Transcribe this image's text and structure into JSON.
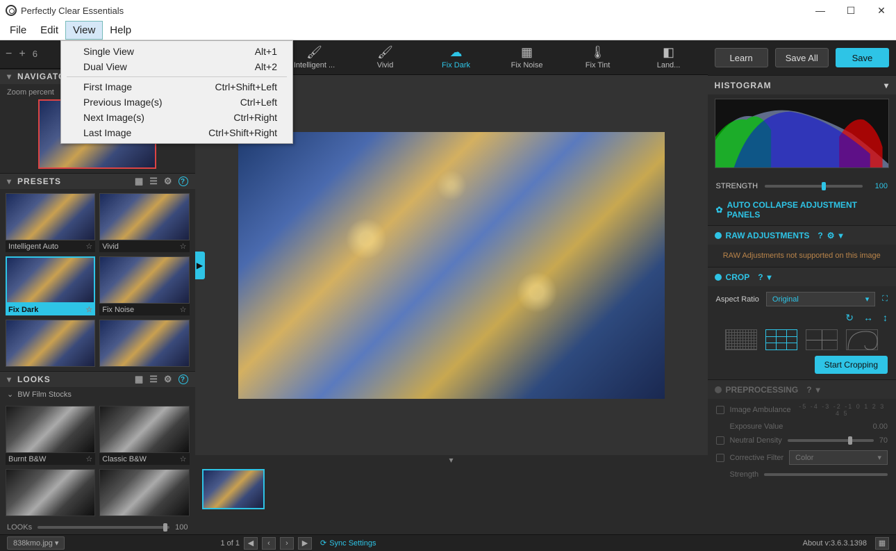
{
  "app": {
    "title": "Perfectly Clear Essentials"
  },
  "menubar": {
    "file": "File",
    "edit": "Edit",
    "view": "View",
    "help": "Help"
  },
  "view_menu": {
    "single_view": "Single View",
    "single_view_key": "Alt+1",
    "dual_view": "Dual View",
    "dual_view_key": "Alt+2",
    "first_image": "First Image",
    "first_image_key": "Ctrl+Shift+Left",
    "previous_image": "Previous Image(s)",
    "previous_image_key": "Ctrl+Left",
    "next_image": "Next Image(s)",
    "next_image_key": "Ctrl+Right",
    "last_image": "Last Image",
    "last_image_key": "Ctrl+Shift+Right"
  },
  "toolbar": {
    "zoom_pct": "6",
    "intelligent": "Intelligent ...",
    "vivid": "Vivid",
    "fix_dark": "Fix Dark",
    "fix_noise": "Fix Noise",
    "fix_tint": "Fix Tint",
    "landscape": "Land..."
  },
  "top_buttons": {
    "learn": "Learn",
    "save_all": "Save All",
    "save": "Save"
  },
  "navigator": {
    "title": "NAVIGATOR",
    "zoom_label": "Zoom percent"
  },
  "presets": {
    "title": "PRESETS",
    "items": [
      {
        "label": "Intelligent Auto"
      },
      {
        "label": "Vivid"
      },
      {
        "label": "Fix Dark"
      },
      {
        "label": "Fix Noise"
      }
    ]
  },
  "looks": {
    "title": "LOOKS",
    "subgroup": "BW Film Stocks",
    "items": [
      {
        "label": "Burnt B&W"
      },
      {
        "label": "Classic B&W"
      }
    ],
    "slider_label": "LOOKs",
    "slider_value": "100"
  },
  "right": {
    "histogram_title": "HISTOGRAM",
    "strength_label": "STRENGTH",
    "strength_value": "100",
    "auto_collapse": "AUTO COLLAPSE ADJUSTMENT PANELS",
    "raw_title": "RAW ADJUSTMENTS",
    "raw_msg": "RAW Adjustments not supported on this image",
    "crop_title": "CROP",
    "aspect_label": "Aspect Ratio",
    "aspect_value": "Original",
    "start_crop": "Start Cropping",
    "prep_title": "PREPROCESSING",
    "image_ambulance": "Image Ambulance",
    "ambulance_ticks": "-5 -4 -3 -2 -1  0  1  2  3  4  5",
    "exposure_value_label": "Exposure Value",
    "exposure_value": "0.00",
    "neutral_density": "Neutral Density",
    "neutral_density_value": "70",
    "corrective_filter": "Corrective Filter",
    "corrective_filter_value": "Color",
    "prep_strength": "Strength"
  },
  "status": {
    "filename": "838kmo.jpg",
    "page": "1 of 1",
    "sync": "Sync Settings",
    "about": "About v:3.6.3.1398"
  }
}
